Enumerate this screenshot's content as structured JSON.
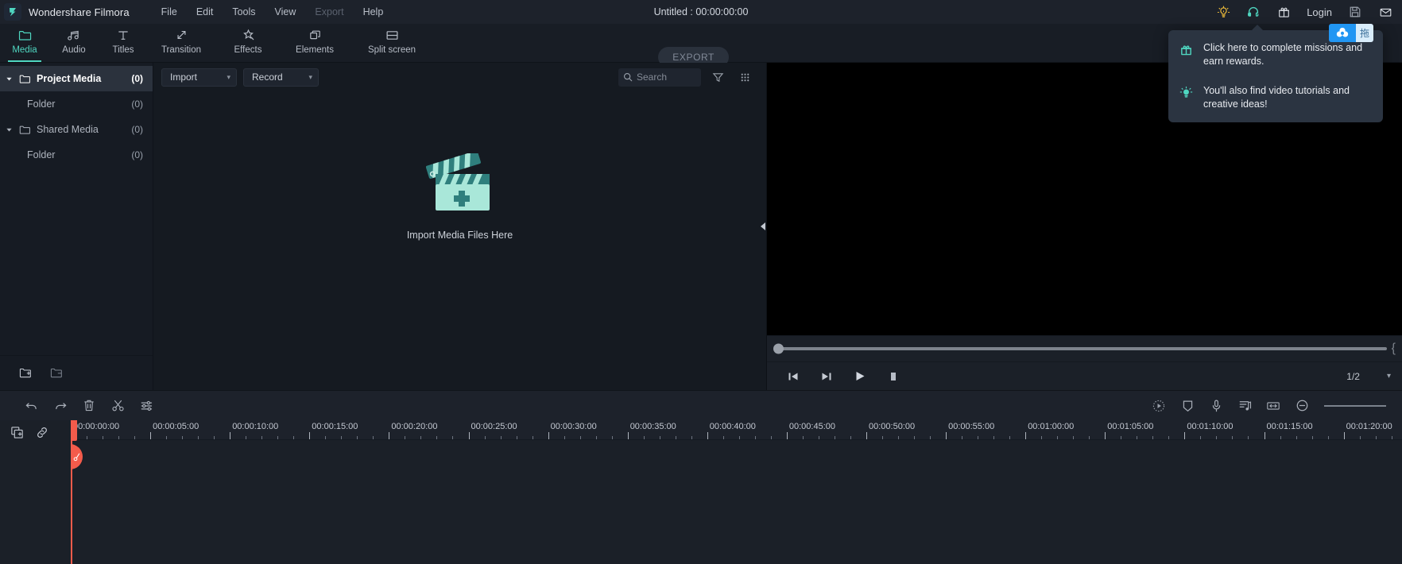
{
  "titlebar": {
    "app_name": "Wondershare Filmora",
    "logo_icon": "filmora-logo-icon",
    "menus": [
      {
        "label": "File",
        "disabled": false
      },
      {
        "label": "Edit",
        "disabled": false
      },
      {
        "label": "Tools",
        "disabled": false
      },
      {
        "label": "View",
        "disabled": false
      },
      {
        "label": "Export",
        "disabled": true
      },
      {
        "label": "Help",
        "disabled": false
      }
    ],
    "project_title": "Untitled : 00:00:00:00",
    "right_icons": [
      {
        "name": "lightbulb-icon",
        "color": "#f5c13a"
      },
      {
        "name": "headset-support-icon",
        "color": "#4fd6c0"
      },
      {
        "name": "gift-icon",
        "color": "#dfe3e9"
      }
    ],
    "login_label": "Login",
    "right_icons_2": [
      {
        "name": "save-icon",
        "color": "#9aa1ac"
      },
      {
        "name": "mail-icon",
        "color": "#dfe3e9"
      }
    ],
    "cloud_badge": {
      "icon": "cloud-drive-icon",
      "label": "拖",
      "accent": "#2196f3"
    }
  },
  "tabbar": {
    "tabs": [
      {
        "label": "Media",
        "icon": "folder-icon",
        "active": true
      },
      {
        "label": "Audio",
        "icon": "music-note-icon",
        "active": false
      },
      {
        "label": "Titles",
        "icon": "text-t-icon",
        "active": false
      },
      {
        "label": "Transition",
        "icon": "transition-arrows-icon",
        "active": false
      },
      {
        "label": "Effects",
        "icon": "star-sparkle-icon",
        "active": false
      },
      {
        "label": "Elements",
        "icon": "layers-icon",
        "active": false
      },
      {
        "label": "Split screen",
        "icon": "split-screen-icon",
        "active": false
      }
    ],
    "export_label": "EXPORT",
    "active_color": "#4fd6c0"
  },
  "tooltip": {
    "items": [
      {
        "icon": "gift-icon",
        "text": "Click here to complete missions and earn rewards."
      },
      {
        "icon": "lightbulb-idea-icon",
        "text": "You'll also find video tutorials and creative ideas!"
      }
    ]
  },
  "sidebar": {
    "tree": [
      {
        "label": "Project Media",
        "count": "(0)",
        "selected": true,
        "indent": false,
        "arrow": true,
        "icon": "folder-icon"
      },
      {
        "label": "Folder",
        "count": "(0)",
        "selected": false,
        "indent": true,
        "arrow": false,
        "icon": ""
      },
      {
        "label": "Shared Media",
        "count": "(0)",
        "selected": false,
        "indent": false,
        "arrow": true,
        "icon": "folder-icon"
      },
      {
        "label": "Folder",
        "count": "(0)",
        "selected": false,
        "indent": true,
        "arrow": false,
        "icon": ""
      }
    ],
    "footer_icons": [
      {
        "name": "add-folder-icon"
      },
      {
        "name": "remove-folder-icon"
      }
    ]
  },
  "media_panel": {
    "import_dropdown": "Import",
    "record_dropdown": "Record",
    "search_placeholder": "Search",
    "search_value": "",
    "filter_icon": "filter-funnel-icon",
    "grid_icon": "grid-view-icon",
    "empty_label": "Import Media Files Here",
    "empty_icon": "clapperboard-plus-icon",
    "collapse_icon": "collapse-left-icon"
  },
  "preview": {
    "scrub_position_pct": 1,
    "controls": [
      {
        "name": "prev-frame-button",
        "icon": "step-backward-icon"
      },
      {
        "name": "next-frame-button",
        "icon": "step-forward-icon"
      },
      {
        "name": "play-button",
        "icon": "play-icon"
      },
      {
        "name": "stop-button",
        "icon": "stop-icon"
      }
    ],
    "zoom_value": "1/2"
  },
  "timeline_toolbar": {
    "left_icons": [
      {
        "name": "undo-button",
        "icon": "undo-arrow-icon"
      },
      {
        "name": "redo-button",
        "icon": "redo-arrow-icon"
      },
      {
        "name": "delete-button",
        "icon": "trash-icon"
      },
      {
        "name": "split-button",
        "icon": "scissors-icon"
      },
      {
        "name": "adjust-button",
        "icon": "sliders-icon"
      }
    ],
    "right_icons": [
      {
        "name": "color-match-button",
        "icon": "dotted-play-circle-icon"
      },
      {
        "name": "marker-button",
        "icon": "marker-shield-icon"
      },
      {
        "name": "voiceover-button",
        "icon": "microphone-icon"
      },
      {
        "name": "audio-detach-button",
        "icon": "audio-note-list-icon"
      },
      {
        "name": "fit-timeline-button",
        "icon": "fit-horizontal-icon"
      },
      {
        "name": "zoom-out-button",
        "icon": "minus-circle-icon"
      }
    ]
  },
  "timeline": {
    "left_icons": [
      {
        "name": "add-track-button",
        "icon": "add-track-icon"
      },
      {
        "name": "link-clips-button",
        "icon": "link-icon"
      }
    ],
    "playhead_time": "00:00:00:00",
    "playhead_icon": "scissor-split-icon",
    "ruler_ticks": [
      "00:00:00:00",
      "00:00:05:00",
      "00:00:10:00",
      "00:00:15:00",
      "00:00:20:00",
      "00:00:25:00",
      "00:00:30:00",
      "00:00:35:00",
      "00:00:40:00",
      "00:00:45:00",
      "00:00:50:00",
      "00:00:55:00",
      "00:01:00:00",
      "00:01:05:00",
      "00:01:10:00",
      "00:01:15:00",
      "00:01:20:00"
    ]
  },
  "theme": {
    "accent": "#4fd6c0",
    "playhead": "#f45b4b",
    "bg_dark": "#1b2028",
    "bg_panel": "#151a21",
    "bg_sidebar": "#161b23"
  }
}
